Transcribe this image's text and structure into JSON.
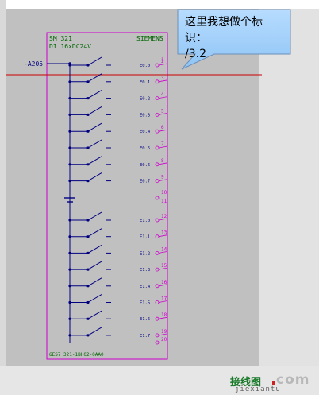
{
  "module": {
    "title": "SM 321",
    "subtitle": "DI 16xDC24V",
    "brand": "SIEMENS",
    "order_number": "6ES7 321-1BH02-0AA0"
  },
  "tag": "-A205",
  "callout": {
    "line1": "这里我想做个标识：",
    "line2": "/3.2"
  },
  "channels_top": [
    {
      "label": "E0.0",
      "terminal": "2"
    },
    {
      "label": "E0.1",
      "terminal": "3"
    },
    {
      "label": "E0.2",
      "terminal": "4"
    },
    {
      "label": "E0.3",
      "terminal": "5"
    },
    {
      "label": "E0.4",
      "terminal": "6"
    },
    {
      "label": "E0.5",
      "terminal": "7"
    },
    {
      "label": "E0.6",
      "terminal": "8"
    },
    {
      "label": "E0.7",
      "terminal": "9"
    }
  ],
  "channels_bottom": [
    {
      "label": "E1.0",
      "terminal": "12"
    },
    {
      "label": "E1.1",
      "terminal": "13"
    },
    {
      "label": "E1.2",
      "terminal": "14"
    },
    {
      "label": "E1.3",
      "terminal": "15"
    },
    {
      "label": "E1.4",
      "terminal": "16"
    },
    {
      "label": "E1.5",
      "terminal": "17"
    },
    {
      "label": "E1.6",
      "terminal": "18"
    },
    {
      "label": "E1.7",
      "terminal": "19"
    }
  ],
  "terminal_1": "1",
  "terminal_10": "10",
  "terminal_11": "11",
  "terminal_20": "20",
  "watermark": {
    "top": "接线图",
    "com": "com",
    "bottom": "jiexiantu"
  },
  "colors": {
    "module_border": "#cc00cc",
    "wire": "#000080",
    "module_text": "#006600",
    "channel_text": "#000080",
    "terminal_text": "#cc00cc",
    "red_line": "#cc0000",
    "callout_fill": "#99ccff"
  }
}
